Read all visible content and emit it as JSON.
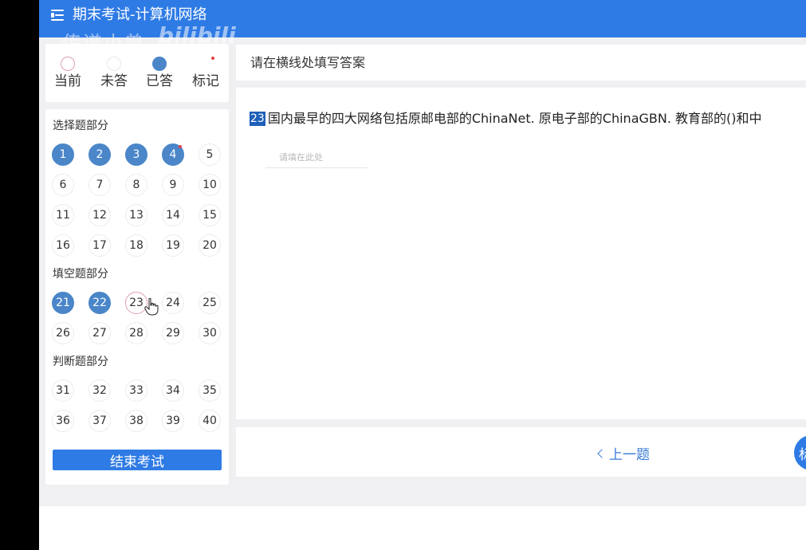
{
  "header": {
    "title": "期末考试-计算机网络"
  },
  "watermark": {
    "text": "传谱小兽",
    "logo": "bilibili"
  },
  "legend": {
    "items": [
      {
        "label": "当前",
        "state": "current"
      },
      {
        "label": "未答",
        "state": "unanswered"
      },
      {
        "label": "已答",
        "state": "answered"
      },
      {
        "label": "标记",
        "state": "marked"
      }
    ]
  },
  "sections": [
    {
      "title": "选择题部分",
      "questions": [
        1,
        2,
        3,
        4,
        5,
        6,
        7,
        8,
        9,
        10,
        11,
        12,
        13,
        14,
        15,
        16,
        17,
        18,
        19,
        20
      ]
    },
    {
      "title": "填空题部分",
      "questions": [
        21,
        22,
        23,
        24,
        25,
        26,
        27,
        28,
        29,
        30
      ]
    },
    {
      "title": "判断题部分",
      "questions": [
        31,
        32,
        33,
        34,
        35,
        36,
        37,
        38,
        39,
        40
      ]
    }
  ],
  "answered": [
    1,
    2,
    3,
    4,
    21,
    22
  ],
  "flagged": [
    4
  ],
  "current": 23,
  "end_button": "结束考试",
  "question": {
    "instruction": "请在横线处填写答案",
    "number": "23",
    "text": "国内最早的四大网络包括原邮电部的ChinaNet. 原电子部的ChinaGBN. 教育部的()和中",
    "placeholder": "请填在此处"
  },
  "footer": {
    "prev_label": "上一题",
    "mark_label": "标"
  },
  "colors": {
    "primary": "#2f7be5",
    "answered": "#4a86c8",
    "current_ring": "#e0a0b0",
    "flag": "#e04040"
  }
}
